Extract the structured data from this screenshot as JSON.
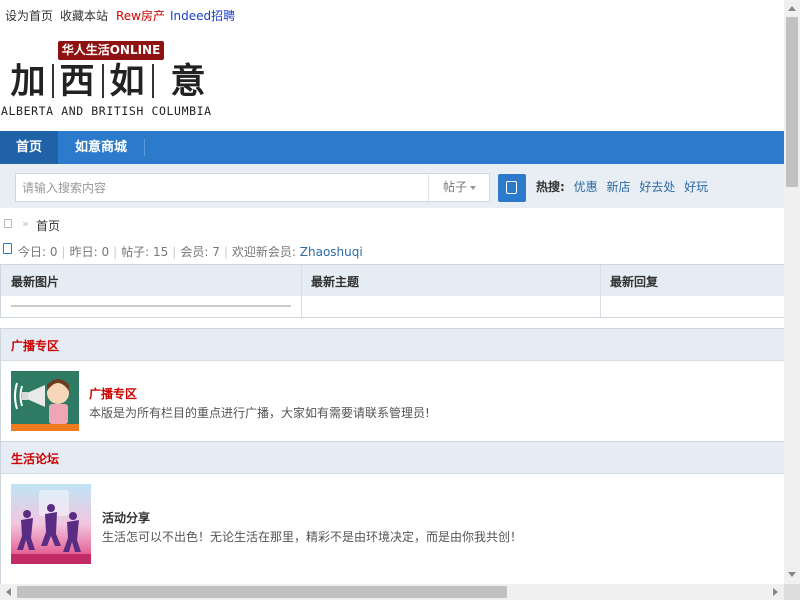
{
  "topbar": {
    "set_home": "设为首页",
    "bookmark": "收藏本站",
    "link_rew": "Rew房产",
    "link_indeed": "Indeed招聘",
    "color_rew": "#cc0000",
    "color_indeed": "#1a3ec2"
  },
  "logo": {
    "badge": "华人生活ONLINE",
    "chars": [
      "加",
      "西",
      "如",
      "意"
    ],
    "subtitle": "ALBERTA AND BRITISH COLUMBIA"
  },
  "nav": {
    "items": [
      {
        "label": "首页",
        "active": true
      },
      {
        "label": "如意商城",
        "active": false
      }
    ],
    "bg_color": "#2b7acb"
  },
  "search": {
    "placeholder": "请输入搜索内容",
    "value": "",
    "type_selected": "帖子",
    "hot_label": "热搜:",
    "hot_terms": [
      "优惠",
      "新店",
      "好去处",
      "好玩"
    ]
  },
  "breadcrumb": {
    "separator": "»",
    "current": "首页"
  },
  "stats": {
    "today_label": "今日:",
    "today": "0",
    "yesterday_label": "昨日:",
    "yesterday": "0",
    "posts_label": "帖子:",
    "posts": "15",
    "members_label": "会员:",
    "members": "7",
    "welcome_label": "欢迎新会员:",
    "newest_member": "Zhaoshuqi"
  },
  "latest": {
    "columns": [
      "最新图片",
      "最新主题",
      "最新回复"
    ]
  },
  "sections": [
    {
      "title": "广播专区",
      "forums": [
        {
          "name": "广播专区",
          "desc": "本版是为所有栏目的重点进行广播，大家如有需要请联系管理员!",
          "icon": "megaphone-girl-icon",
          "name_color": "#cc0000"
        }
      ]
    },
    {
      "title": "生活论坛",
      "forums": [
        {
          "name": "活动分享",
          "desc": "生活怎可以不出色！无论生活在那里，精彩不是由环境决定，而是由你我共创！",
          "icon": "jumping-people-icon",
          "name_color": "#333333"
        }
      ]
    }
  ]
}
